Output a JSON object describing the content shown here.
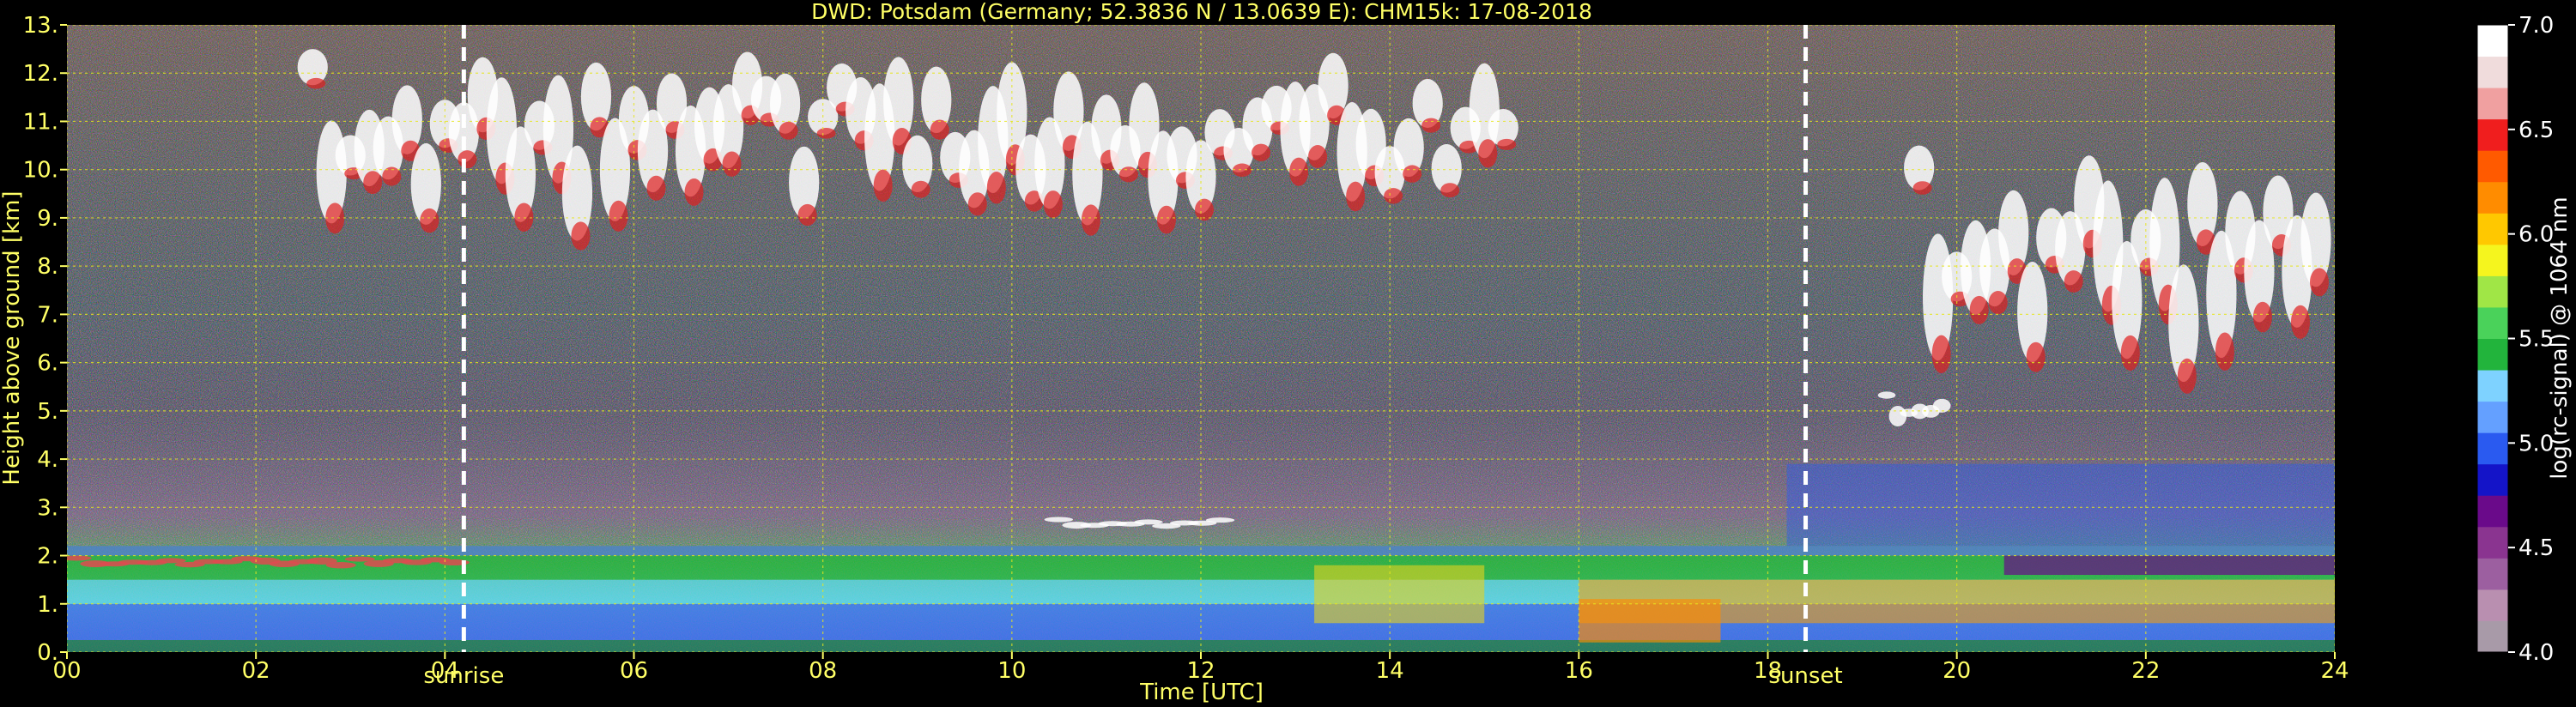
{
  "chart_data": {
    "type": "heatmap",
    "title": "DWD: Potsdam (Germany; 52.3836 N / 13.0639 E):    CHM15k: 17-08-2018",
    "xlabel": "Time [UTC]",
    "ylabel": "Height above ground [km]",
    "xlim": [
      0,
      24
    ],
    "ylim": [
      0,
      13
    ],
    "x_ticks": [
      0,
      2,
      4,
      6,
      8,
      10,
      12,
      14,
      16,
      18,
      20,
      22,
      24
    ],
    "x_tick_labels": [
      "00",
      "02",
      "04",
      "06",
      "08",
      "10",
      "12",
      "14",
      "16",
      "18",
      "20",
      "22",
      "24"
    ],
    "y_ticks": [
      0,
      1,
      2,
      3,
      4,
      5,
      6,
      7,
      8,
      9,
      10,
      11,
      12,
      13
    ],
    "y_tick_labels": [
      "0.",
      "1.",
      "2.",
      "3.",
      "4.",
      "5.",
      "6.",
      "7.",
      "8.",
      "9.",
      "10.",
      "11.",
      "12.",
      "13."
    ],
    "grid": true,
    "markers": [
      {
        "label": "sunrise",
        "time": 4.2
      },
      {
        "label": "sunset",
        "time": 18.4
      }
    ],
    "colorbar": {
      "label": "log(rc-signal) @ 1064 nm",
      "range": [
        4.0,
        7.0
      ],
      "ticks": [
        4.0,
        4.5,
        5.0,
        5.5,
        6.0,
        6.5,
        7.0
      ],
      "tick_labels": [
        "4.0",
        "4.5",
        "5.0",
        "5.5",
        "6.0",
        "6.5",
        "7.0"
      ],
      "colors": [
        "#a89aa8",
        "#b98fb0",
        "#9c5fa0",
        "#8a3490",
        "#6a0a8a",
        "#1414c8",
        "#2a5af0",
        "#64a0ff",
        "#7ed2ff",
        "#22b43c",
        "#4ad25a",
        "#a0e646",
        "#f5f51e",
        "#ffc800",
        "#ff8c00",
        "#ff5a00",
        "#f01e1e",
        "#f0a0a0",
        "#f0dcdc",
        "#ffffff"
      ]
    },
    "features": [
      {
        "name": "boundary layer",
        "time_range": [
          0,
          24
        ],
        "height_range": [
          0,
          2.2
        ]
      },
      {
        "name": "residual layer top",
        "time_range": [
          0,
          4.2
        ],
        "height_range": [
          1.8,
          2.0
        ]
      },
      {
        "name": "high cirrus",
        "time_range": [
          2.5,
          15.3
        ],
        "height_range": [
          9.5,
          12.5
        ]
      },
      {
        "name": "evening cirrus",
        "time_range": [
          19.5,
          23.9
        ],
        "height_range": [
          6.8,
          10.5
        ]
      },
      {
        "name": "mid-level cloud",
        "time_range": [
          19.2,
          19.9
        ],
        "height_range": [
          4.8,
          5.4
        ]
      },
      {
        "name": "cloud base layer",
        "time_range": [
          10.4,
          12.3
        ],
        "height_range": [
          2.6,
          2.8
        ]
      }
    ]
  }
}
